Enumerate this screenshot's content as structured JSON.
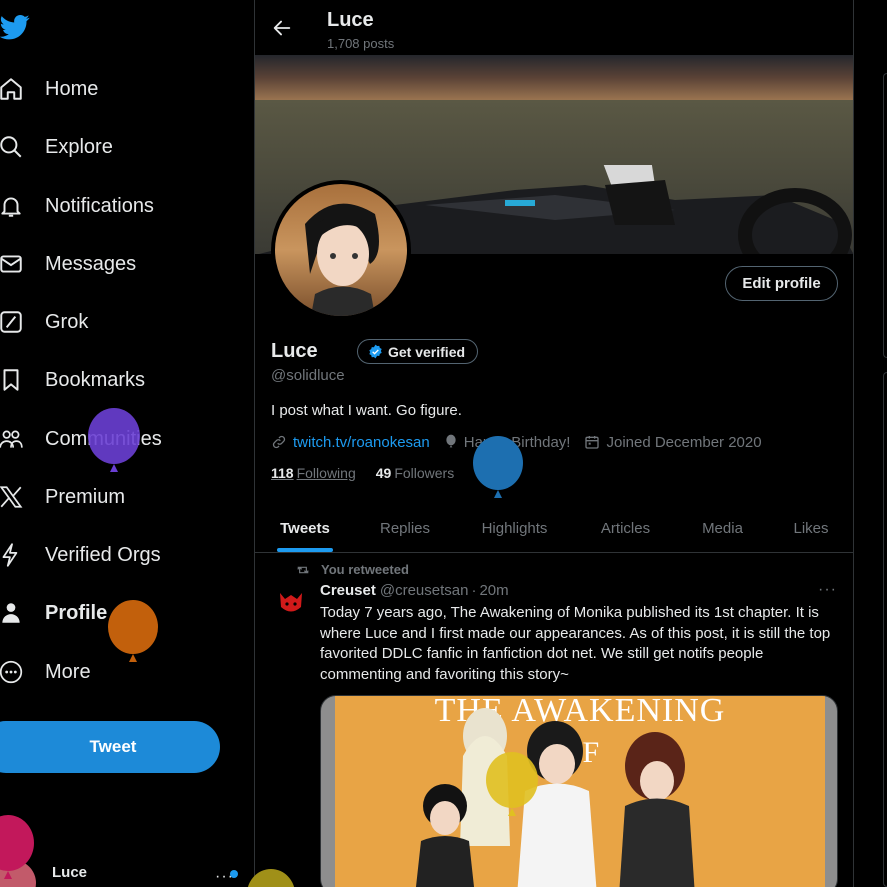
{
  "sidebar": {
    "logo": "twitter-bird-icon",
    "items": [
      {
        "label": "Home",
        "icon": "home-icon"
      },
      {
        "label": "Explore",
        "icon": "search-icon"
      },
      {
        "label": "Notifications",
        "icon": "bell-icon"
      },
      {
        "label": "Messages",
        "icon": "envelope-icon"
      },
      {
        "label": "Grok",
        "icon": "grok-icon"
      },
      {
        "label": "Bookmarks",
        "icon": "bookmark-icon"
      },
      {
        "label": "Communities",
        "icon": "people-icon"
      },
      {
        "label": "Premium",
        "icon": "x-logo-icon"
      },
      {
        "label": "Verified Orgs",
        "icon": "lightning-icon"
      },
      {
        "label": "Profile",
        "icon": "person-icon",
        "active": true
      },
      {
        "label": "More",
        "icon": "more-circle-icon"
      }
    ],
    "tweet_button": "Tweet",
    "account": {
      "name": "Luce",
      "more": "···"
    }
  },
  "header": {
    "title": "Luce",
    "subtitle": "1,708 posts"
  },
  "profile": {
    "edit_button": "Edit profile",
    "name": "Luce",
    "verify_button": "Get verified",
    "handle": "@solidluce",
    "bio": "I post what I want. Go figure.",
    "link": "twitch.tv/roanokesan",
    "birthday": "Happy Birthday!",
    "joined": "Joined December 2020",
    "following_count": "118",
    "following_label": "Following",
    "followers_count": "49",
    "followers_label": "Followers"
  },
  "tabs": [
    "Tweets",
    "Replies",
    "Highlights",
    "Articles",
    "Media",
    "Likes"
  ],
  "active_tab": "Tweets",
  "tweet": {
    "retweet_label": "You retweeted",
    "name": "Creuset",
    "handle": "@creusetsan",
    "separator": "·",
    "time": "20m",
    "more": "···",
    "text": "Today 7 years ago, The Awakening of Monika published its 1st chapter. It is where Luce and I first made our appearances. As of this post, it is still the top favorited DDLC fanfic in fanfiction dot net. We still get notifs people commenting and favoriting this story~",
    "media_title": "THE AWAKENING",
    "media_subtitle": "OF"
  },
  "colors": {
    "accent": "#1d9bf0",
    "tweet_button": "#1d8ad8",
    "background": "#000000",
    "muted_text": "#71767b"
  },
  "overlay_balloons": [
    "purple",
    "blue",
    "orange",
    "yellow",
    "pink",
    "olive"
  ]
}
